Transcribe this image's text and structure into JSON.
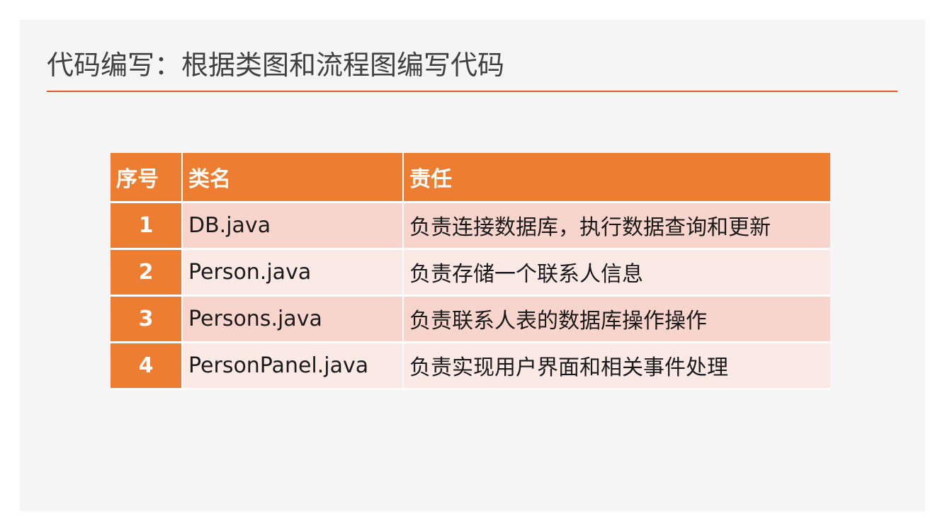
{
  "title": "代码编写：根据类图和流程图编写代码",
  "colors": {
    "accent": "#ed7d31",
    "rule": "#e8542a",
    "row_dark": "#f8d5cc",
    "row_light": "#fbe9e6"
  },
  "table": {
    "headers": [
      "序号",
      "类名",
      "责任"
    ],
    "rows": [
      {
        "no": "1",
        "class_name": "DB.java",
        "duty": "负责连接数据库，执行数据查询和更新"
      },
      {
        "no": "2",
        "class_name": "Person.java",
        "duty": "负责存储一个联系人信息"
      },
      {
        "no": "3",
        "class_name": "Persons.java",
        "duty": "负责联系人表的数据库操作操作"
      },
      {
        "no": "4",
        "class_name": "PersonPanel.java",
        "duty": "负责实现用户界面和相关事件处理"
      }
    ]
  }
}
